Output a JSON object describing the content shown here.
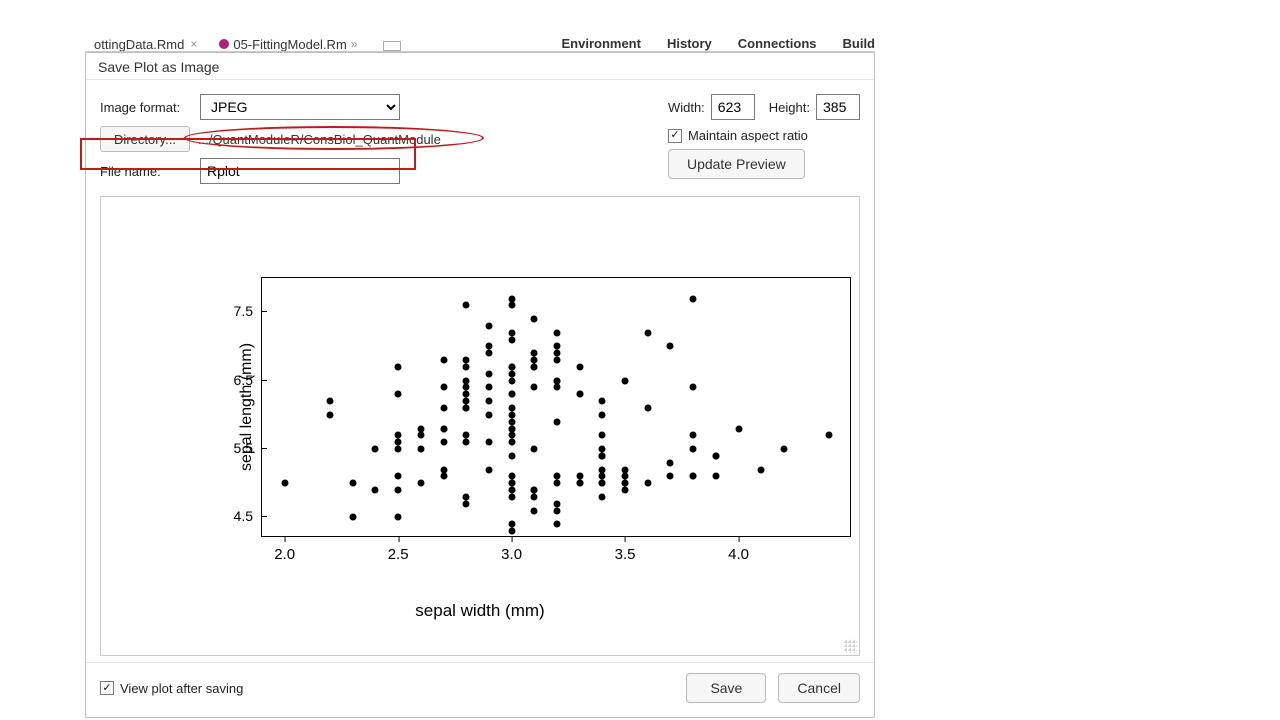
{
  "tabs": {
    "left1": "ottingData.Rmd",
    "left2": "05-FittingModel.Rm"
  },
  "panes": {
    "env": "Environment",
    "hist": "History",
    "conn": "Connections",
    "build": "Build"
  },
  "dialog": {
    "title": "Save Plot as Image",
    "format_label": "Image format:",
    "format_value": "JPEG",
    "directory_button": "Directory...",
    "directory_path": ".../QuantModuleR/ConsBiol_QuantModule",
    "filename_label": "File name:",
    "filename_value": "Rplot",
    "width_label": "Width:",
    "width_value": "623",
    "height_label": "Height:",
    "height_value": "385",
    "aspect_label": "Maintain aspect ratio",
    "update_button": "Update Preview",
    "view_after_label": "View plot after saving",
    "save_button": "Save",
    "cancel_button": "Cancel"
  },
  "chart_data": {
    "type": "scatter",
    "xlabel": "sepal width (mm)",
    "ylabel": "sepal length (mm)",
    "xlim": [
      1.9,
      4.5
    ],
    "ylim": [
      4.2,
      8.0
    ],
    "xticks": [
      2.0,
      2.5,
      3.0,
      3.5,
      4.0
    ],
    "yticks": [
      4.5,
      5.5,
      6.5,
      7.5
    ],
    "x": [
      2.0,
      2.2,
      2.2,
      2.3,
      2.3,
      2.4,
      2.4,
      2.5,
      2.5,
      2.5,
      2.5,
      2.5,
      2.5,
      2.5,
      2.5,
      2.6,
      2.6,
      2.6,
      2.6,
      2.7,
      2.7,
      2.7,
      2.7,
      2.7,
      2.7,
      2.7,
      2.7,
      2.8,
      2.8,
      2.8,
      2.8,
      2.8,
      2.8,
      2.8,
      2.8,
      2.8,
      2.8,
      2.8,
      2.8,
      2.8,
      2.9,
      2.9,
      2.9,
      2.9,
      2.9,
      2.9,
      2.9,
      2.9,
      2.9,
      3.0,
      3.0,
      3.0,
      3.0,
      3.0,
      3.0,
      3.0,
      3.0,
      3.0,
      3.0,
      3.0,
      3.0,
      3.0,
      3.0,
      3.0,
      3.0,
      3.0,
      3.0,
      3.0,
      3.0,
      3.0,
      3.0,
      3.0,
      3.0,
      3.0,
      3.1,
      3.1,
      3.1,
      3.1,
      3.1,
      3.1,
      3.1,
      3.1,
      3.1,
      3.1,
      3.1,
      3.2,
      3.2,
      3.2,
      3.2,
      3.2,
      3.2,
      3.2,
      3.2,
      3.2,
      3.2,
      3.2,
      3.2,
      3.2,
      3.3,
      3.3,
      3.3,
      3.3,
      3.3,
      3.3,
      3.4,
      3.4,
      3.4,
      3.4,
      3.4,
      3.4,
      3.4,
      3.4,
      3.4,
      3.4,
      3.4,
      3.4,
      3.5,
      3.5,
      3.5,
      3.5,
      3.5,
      3.5,
      3.6,
      3.6,
      3.6,
      3.7,
      3.7,
      3.7,
      3.8,
      3.8,
      3.8,
      3.8,
      3.8,
      3.8,
      3.9,
      3.9,
      3.9,
      4.0,
      4.1,
      4.2,
      4.4
    ],
    "y": [
      5.0,
      6.0,
      6.2,
      5.0,
      4.5,
      5.5,
      4.9,
      6.3,
      5.5,
      4.9,
      5.1,
      6.7,
      5.7,
      4.5,
      5.6,
      5.8,
      5.7,
      5.5,
      5.0,
      5.6,
      5.2,
      5.8,
      6.4,
      6.1,
      5.1,
      6.8,
      5.8,
      7.6,
      6.5,
      6.2,
      6.8,
      5.6,
      4.7,
      6.1,
      6.1,
      5.7,
      6.3,
      6.4,
      4.8,
      6.7,
      6.6,
      6.2,
      6.0,
      5.6,
      7.3,
      7.0,
      5.2,
      6.4,
      6.9,
      5.6,
      5.4,
      6.1,
      5.9,
      5.0,
      6.6,
      5.1,
      6.7,
      5.7,
      6.5,
      7.7,
      5.8,
      6.0,
      4.9,
      4.8,
      4.3,
      4.4,
      6.7,
      7.1,
      7.2,
      6.3,
      5.0,
      7.6,
      5.8,
      6.3,
      4.6,
      4.9,
      4.8,
      6.7,
      5.5,
      6.9,
      4.9,
      6.7,
      6.4,
      6.8,
      7.4,
      6.5,
      5.0,
      4.7,
      6.9,
      5.9,
      6.4,
      4.6,
      5.1,
      6.5,
      4.4,
      7.0,
      7.2,
      6.8,
      5.0,
      5.1,
      5.0,
      6.3,
      6.7,
      6.3,
      6.2,
      5.4,
      5.0,
      4.8,
      5.2,
      6.0,
      5.1,
      5.0,
      5.4,
      5.7,
      5.4,
      5.5,
      5.0,
      5.2,
      5.0,
      5.1,
      4.9,
      6.5,
      7.2,
      5.0,
      6.1,
      7.0,
      5.3,
      5.1,
      5.7,
      6.4,
      5.1,
      5.1,
      5.5,
      7.7,
      5.4,
      5.1,
      5.4,
      5.8,
      5.2,
      5.5,
      5.7
    ]
  }
}
